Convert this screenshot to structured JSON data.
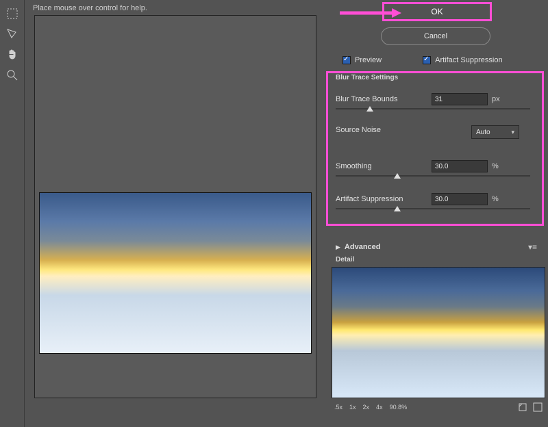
{
  "help_text": "Place mouse over control for help.",
  "buttons": {
    "ok": "OK",
    "cancel": "Cancel"
  },
  "checks": {
    "preview": "Preview",
    "artifact": "Artifact Suppression"
  },
  "section_title": "Blur Trace Settings",
  "sliders": {
    "bounds": {
      "label": "Blur Trace Bounds",
      "value": "31",
      "unit": "px",
      "pos": 16
    },
    "smoothing": {
      "label": "Smoothing",
      "value": "30.0",
      "unit": "%",
      "pos": 30
    },
    "artifact": {
      "label": "Artifact Suppression",
      "value": "30.0",
      "unit": "%",
      "pos": 30
    }
  },
  "source_noise": {
    "label": "Source Noise",
    "value": "Auto"
  },
  "advanced": "Advanced",
  "detail": "Detail",
  "zoom": {
    "l1": ".5x",
    "l2": "1x",
    "l3": "2x",
    "l4": "4x",
    "pct": "90.8%"
  }
}
